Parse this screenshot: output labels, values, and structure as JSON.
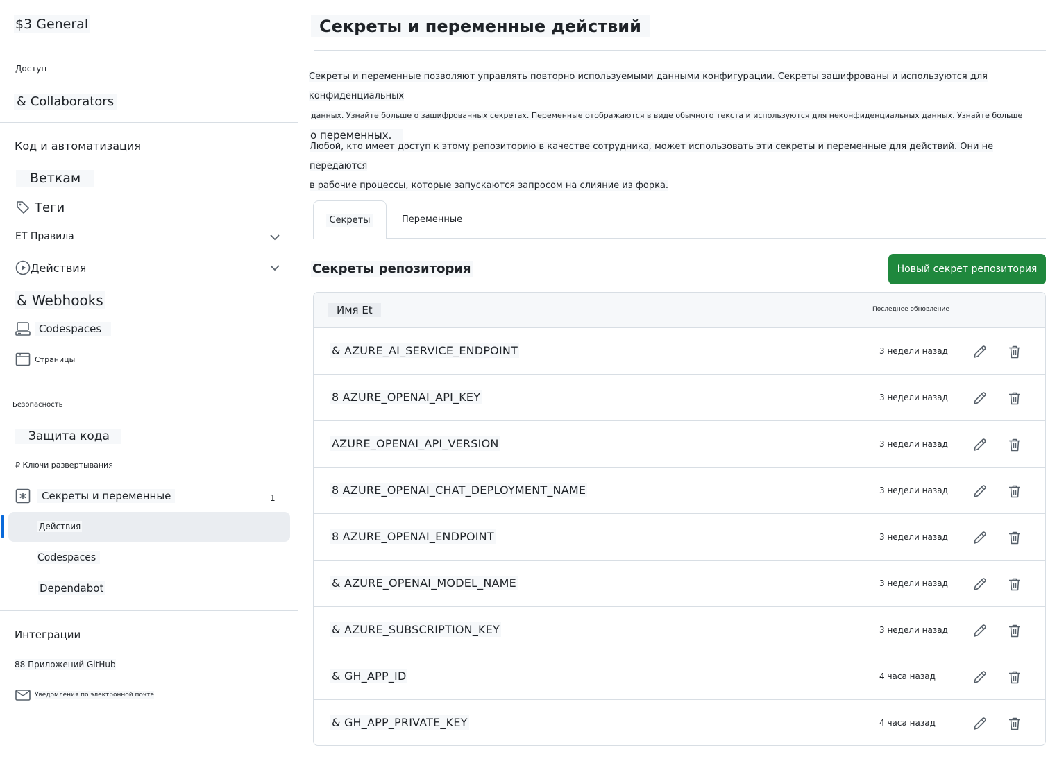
{
  "sidebar": {
    "title": "$3 General",
    "sections": {
      "access": "Доступ",
      "code_automation": "Код и автоматизация",
      "security": "Безопасность",
      "integrations": "Интеграции"
    },
    "items": {
      "collaborators": "& Collaborators",
      "branches": "Веткам",
      "tags": "Теги",
      "rules": "ЕТ Правила",
      "actions": "Действия",
      "webhooks": "& Webhooks",
      "codespaces": "Codespaces",
      "pages": "Страницы",
      "code_protection": "Защита кода",
      "deploy_keys": "₽ Ключи развертывания",
      "secrets_vars": "Секреты и переменные",
      "secrets_count": "1",
      "sub_actions": "Действия",
      "sub_codespaces": "Codespaces",
      "sub_dependabot": "Dependabot",
      "github_apps": "88 Приложений GitHub",
      "email_notifications": "Уведомления по электронной почте"
    }
  },
  "main": {
    "title": "Секреты и переменные действий",
    "desc1": "Секреты и переменные позволяют управлять повторно используемыми данными конфигурации. Секреты зашифрованы и используются для конфиденциальных",
    "desc2": "данных. Узнайте больше о зашифрованных секретах. Переменные отображаются в виде обычного текста и используются для неконфиденциальных данных. Узнайте больше",
    "desc3": "о переменных.",
    "desc4": "Любой, кто имеет доступ к этому репозиторию в качестве сотрудника, может использовать эти секреты и переменные для действий. Они не передаются",
    "desc5": "в рабочие процессы, которые запускаются запросом на слияние из форка.",
    "tabs": {
      "secrets": "Секреты",
      "variables": "Переменные"
    },
    "section_title": "Секреты репозитория",
    "new_button": "Новый секрет репозитория",
    "table": {
      "col_name": "Имя Et",
      "col_updated": "Последнее обновление",
      "rows": [
        {
          "name": "& AZURE_AI_SERVICE_ENDPOINT",
          "updated": "3 недели назад"
        },
        {
          "name": "8  AZURE_OPENAI_API_KEY",
          "updated": "3 недели назад"
        },
        {
          "name": "AZURE_OPENAI_API_VERSION",
          "updated": "3 недели назад"
        },
        {
          "name": "8  AZURE_OPENAI_CHAT_DEPLOYMENT_NAME",
          "updated": "3 недели назад"
        },
        {
          "name": "8  AZURE_OPENAI_ENDPOINT",
          "updated": "3 недели назад"
        },
        {
          "name": "& AZURE_OPENAI_MODEL_NAME",
          "updated": "3 недели назад"
        },
        {
          "name": "& AZURE_SUBSCRIPTION_KEY",
          "updated": "3 недели назад"
        },
        {
          "name": "& GH_APP_ID",
          "updated": "4 часа назад"
        },
        {
          "name": "& GH_APP_PRIVATE_KEY",
          "updated": "4 часа назад"
        }
      ]
    }
  },
  "colors": {
    "primary_button": "#1f883d",
    "active_accent": "#0969da",
    "border": "#d8dee4"
  }
}
